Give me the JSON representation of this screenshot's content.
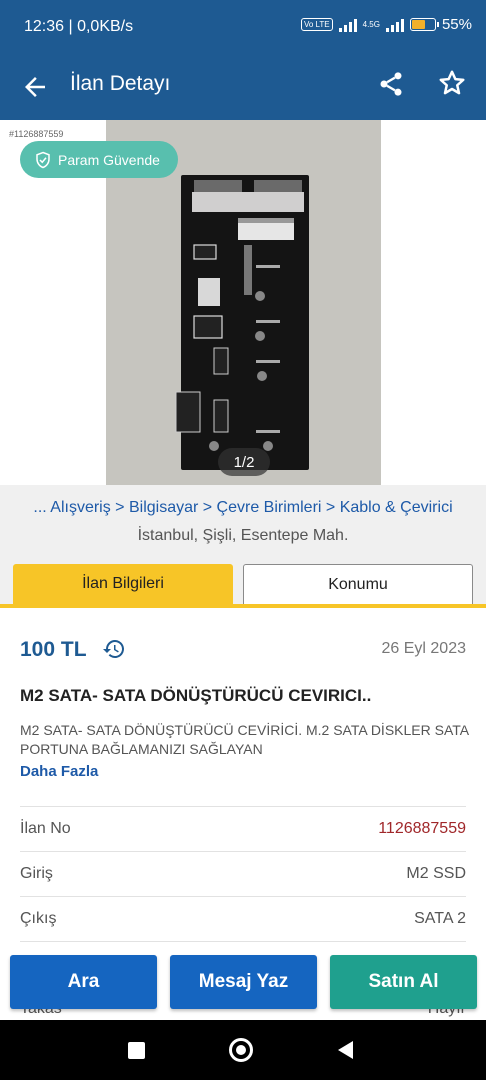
{
  "status_bar": {
    "time_network": "12:36 | 0,0KB/s",
    "volte": "Vo LTE",
    "network": "4.5G",
    "battery": "55%"
  },
  "app_bar": {
    "title": "İlan Detayı"
  },
  "gallery": {
    "listing_ref": "#1126887559",
    "guarantee_label": "Param Güvende",
    "counter": "1/2"
  },
  "breadcrumb": "... Alışveriş > Bilgisayar > Çevre Birimleri > Kablo & Çevirici",
  "location": "İstanbul, Şişli, Esentepe Mah.",
  "tabs": [
    {
      "label": "İlan Bilgileri",
      "active": true
    },
    {
      "label": "Konumu",
      "active": false
    }
  ],
  "listing": {
    "price": "100 TL",
    "date": "26 Eyl 2023",
    "title": "M2 SATA- SATA DÖNÜŞTÜRÜCÜ CEVIRICI..",
    "description": "M2 SATA- SATA DÖNÜŞTÜRÜCÜ CEVİRİCİ. M.2 SATA DİSKLER SATA PORTUNA BAĞLAMANIZI SAĞLAYAN",
    "more_label": "Daha Fazla"
  },
  "details": [
    {
      "key": "İlan No",
      "value": "1126887559"
    },
    {
      "key": "Giriş",
      "value": "M2 SSD"
    },
    {
      "key": "Çıkış",
      "value": "SATA 2"
    },
    {
      "key": "Takas",
      "value": "Hayır"
    }
  ],
  "actions": {
    "call": "Ara",
    "message": "Mesaj Yaz",
    "buy": "Satın Al"
  },
  "colors": {
    "primary": "#1e5a92",
    "accent_yellow": "#f7c527",
    "buy_green": "#1fa08e",
    "button_blue": "#1565c0"
  }
}
